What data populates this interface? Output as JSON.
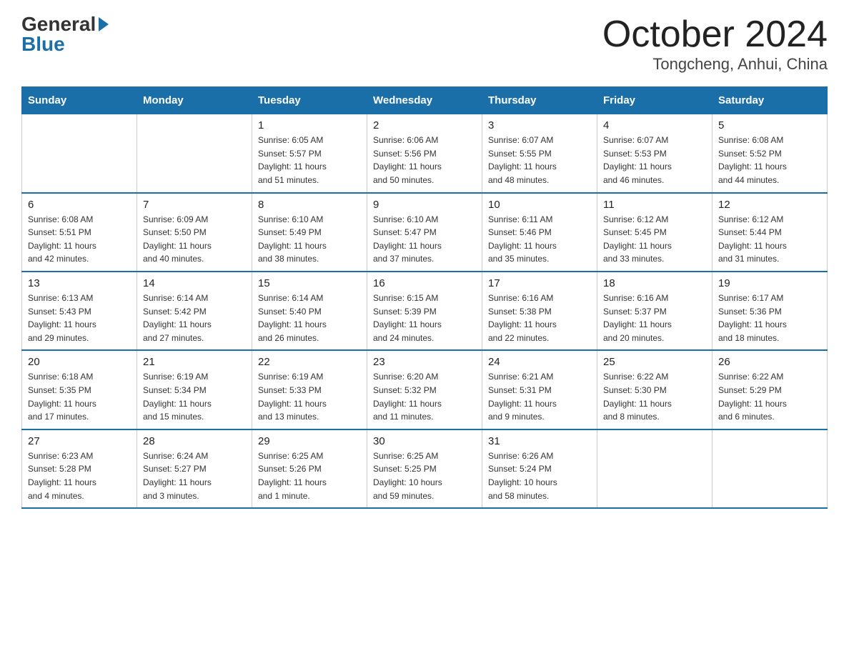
{
  "logo": {
    "general": "General",
    "blue": "Blue"
  },
  "title": "October 2024",
  "location": "Tongcheng, Anhui, China",
  "days_header": [
    "Sunday",
    "Monday",
    "Tuesday",
    "Wednesday",
    "Thursday",
    "Friday",
    "Saturday"
  ],
  "weeks": [
    [
      {
        "day": "",
        "info": ""
      },
      {
        "day": "",
        "info": ""
      },
      {
        "day": "1",
        "info": "Sunrise: 6:05 AM\nSunset: 5:57 PM\nDaylight: 11 hours\nand 51 minutes."
      },
      {
        "day": "2",
        "info": "Sunrise: 6:06 AM\nSunset: 5:56 PM\nDaylight: 11 hours\nand 50 minutes."
      },
      {
        "day": "3",
        "info": "Sunrise: 6:07 AM\nSunset: 5:55 PM\nDaylight: 11 hours\nand 48 minutes."
      },
      {
        "day": "4",
        "info": "Sunrise: 6:07 AM\nSunset: 5:53 PM\nDaylight: 11 hours\nand 46 minutes."
      },
      {
        "day": "5",
        "info": "Sunrise: 6:08 AM\nSunset: 5:52 PM\nDaylight: 11 hours\nand 44 minutes."
      }
    ],
    [
      {
        "day": "6",
        "info": "Sunrise: 6:08 AM\nSunset: 5:51 PM\nDaylight: 11 hours\nand 42 minutes."
      },
      {
        "day": "7",
        "info": "Sunrise: 6:09 AM\nSunset: 5:50 PM\nDaylight: 11 hours\nand 40 minutes."
      },
      {
        "day": "8",
        "info": "Sunrise: 6:10 AM\nSunset: 5:49 PM\nDaylight: 11 hours\nand 38 minutes."
      },
      {
        "day": "9",
        "info": "Sunrise: 6:10 AM\nSunset: 5:47 PM\nDaylight: 11 hours\nand 37 minutes."
      },
      {
        "day": "10",
        "info": "Sunrise: 6:11 AM\nSunset: 5:46 PM\nDaylight: 11 hours\nand 35 minutes."
      },
      {
        "day": "11",
        "info": "Sunrise: 6:12 AM\nSunset: 5:45 PM\nDaylight: 11 hours\nand 33 minutes."
      },
      {
        "day": "12",
        "info": "Sunrise: 6:12 AM\nSunset: 5:44 PM\nDaylight: 11 hours\nand 31 minutes."
      }
    ],
    [
      {
        "day": "13",
        "info": "Sunrise: 6:13 AM\nSunset: 5:43 PM\nDaylight: 11 hours\nand 29 minutes."
      },
      {
        "day": "14",
        "info": "Sunrise: 6:14 AM\nSunset: 5:42 PM\nDaylight: 11 hours\nand 27 minutes."
      },
      {
        "day": "15",
        "info": "Sunrise: 6:14 AM\nSunset: 5:40 PM\nDaylight: 11 hours\nand 26 minutes."
      },
      {
        "day": "16",
        "info": "Sunrise: 6:15 AM\nSunset: 5:39 PM\nDaylight: 11 hours\nand 24 minutes."
      },
      {
        "day": "17",
        "info": "Sunrise: 6:16 AM\nSunset: 5:38 PM\nDaylight: 11 hours\nand 22 minutes."
      },
      {
        "day": "18",
        "info": "Sunrise: 6:16 AM\nSunset: 5:37 PM\nDaylight: 11 hours\nand 20 minutes."
      },
      {
        "day": "19",
        "info": "Sunrise: 6:17 AM\nSunset: 5:36 PM\nDaylight: 11 hours\nand 18 minutes."
      }
    ],
    [
      {
        "day": "20",
        "info": "Sunrise: 6:18 AM\nSunset: 5:35 PM\nDaylight: 11 hours\nand 17 minutes."
      },
      {
        "day": "21",
        "info": "Sunrise: 6:19 AM\nSunset: 5:34 PM\nDaylight: 11 hours\nand 15 minutes."
      },
      {
        "day": "22",
        "info": "Sunrise: 6:19 AM\nSunset: 5:33 PM\nDaylight: 11 hours\nand 13 minutes."
      },
      {
        "day": "23",
        "info": "Sunrise: 6:20 AM\nSunset: 5:32 PM\nDaylight: 11 hours\nand 11 minutes."
      },
      {
        "day": "24",
        "info": "Sunrise: 6:21 AM\nSunset: 5:31 PM\nDaylight: 11 hours\nand 9 minutes."
      },
      {
        "day": "25",
        "info": "Sunrise: 6:22 AM\nSunset: 5:30 PM\nDaylight: 11 hours\nand 8 minutes."
      },
      {
        "day": "26",
        "info": "Sunrise: 6:22 AM\nSunset: 5:29 PM\nDaylight: 11 hours\nand 6 minutes."
      }
    ],
    [
      {
        "day": "27",
        "info": "Sunrise: 6:23 AM\nSunset: 5:28 PM\nDaylight: 11 hours\nand 4 minutes."
      },
      {
        "day": "28",
        "info": "Sunrise: 6:24 AM\nSunset: 5:27 PM\nDaylight: 11 hours\nand 3 minutes."
      },
      {
        "day": "29",
        "info": "Sunrise: 6:25 AM\nSunset: 5:26 PM\nDaylight: 11 hours\nand 1 minute."
      },
      {
        "day": "30",
        "info": "Sunrise: 6:25 AM\nSunset: 5:25 PM\nDaylight: 10 hours\nand 59 minutes."
      },
      {
        "day": "31",
        "info": "Sunrise: 6:26 AM\nSunset: 5:24 PM\nDaylight: 10 hours\nand 58 minutes."
      },
      {
        "day": "",
        "info": ""
      },
      {
        "day": "",
        "info": ""
      }
    ]
  ]
}
